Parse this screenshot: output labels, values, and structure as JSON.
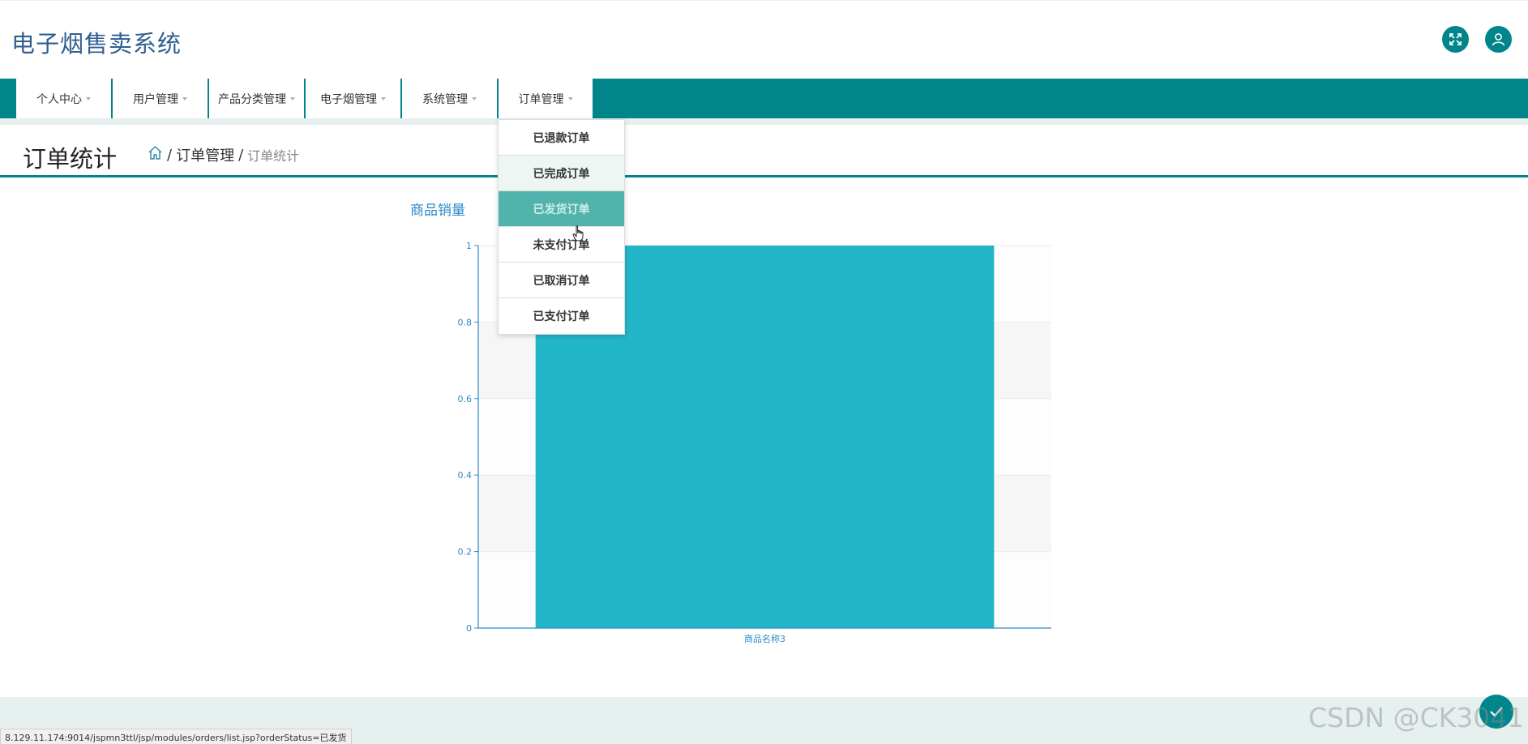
{
  "app": {
    "title": "电子烟售卖系统"
  },
  "header_icons": {
    "fullscreen": "fullscreen-icon",
    "user": "user-icon"
  },
  "nav": {
    "items": [
      {
        "label": "个人中心"
      },
      {
        "label": "用户管理"
      },
      {
        "label": "产品分类管理"
      },
      {
        "label": "电子烟管理"
      },
      {
        "label": "系统管理"
      },
      {
        "label": "订单管理"
      }
    ]
  },
  "dropdown": {
    "items": [
      {
        "label": "已退款订单"
      },
      {
        "label": "已完成订单"
      },
      {
        "label": "已发货订单"
      },
      {
        "label": "未支付订单"
      },
      {
        "label": "已取消订单"
      },
      {
        "label": "已支付订单"
      }
    ]
  },
  "page": {
    "title": "订单统计",
    "breadcrumb": {
      "separator": "/",
      "parent": "订单管理",
      "current": "订单统计"
    }
  },
  "chart_data": {
    "type": "bar",
    "title": "商品销量",
    "categories": [
      "商品名称3"
    ],
    "values": [
      1
    ],
    "ylim": [
      0,
      1
    ],
    "yticks": [
      "0",
      "0.2",
      "0.4",
      "0.6",
      "0.8",
      "1"
    ],
    "grid": true,
    "colors": {
      "bar": "#22b5c8",
      "axis": "#2b8ac9"
    }
  },
  "status_bar": {
    "url": "8.129.11.174:9014/jspmn3ttl/jsp/modules/orders/list.jsp?orderStatus=已发货"
  },
  "watermark": "CSDN @CK3041",
  "colors": {
    "primary": "#00858a",
    "title_blue": "#2f5f8f",
    "dropdown_active": "#52b3ad"
  }
}
